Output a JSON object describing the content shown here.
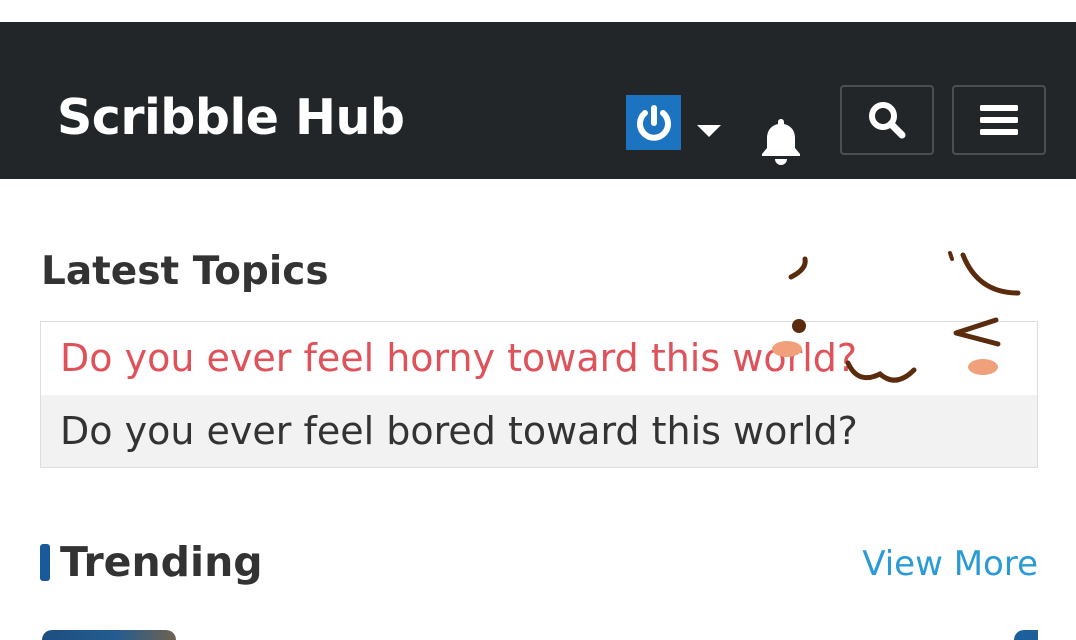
{
  "header": {
    "brand": "Scribble Hub",
    "avatar_icon": "power-icon",
    "notifications_icon": "bell-icon",
    "search_icon": "search-icon",
    "menu_icon": "hamburger-menu-icon",
    "accent": "#1c73c0"
  },
  "latest_topics": {
    "title": "Latest Topics",
    "items": [
      {
        "label": "Do you ever feel horny toward this world?",
        "color": "#e0525a"
      },
      {
        "label": "Do you ever feel bored toward this world?",
        "color": "#333333"
      }
    ]
  },
  "trending": {
    "title": "Trending",
    "view_more": "View More",
    "accent": "#1a5a9b",
    "link_color": "#2a9bd6"
  }
}
